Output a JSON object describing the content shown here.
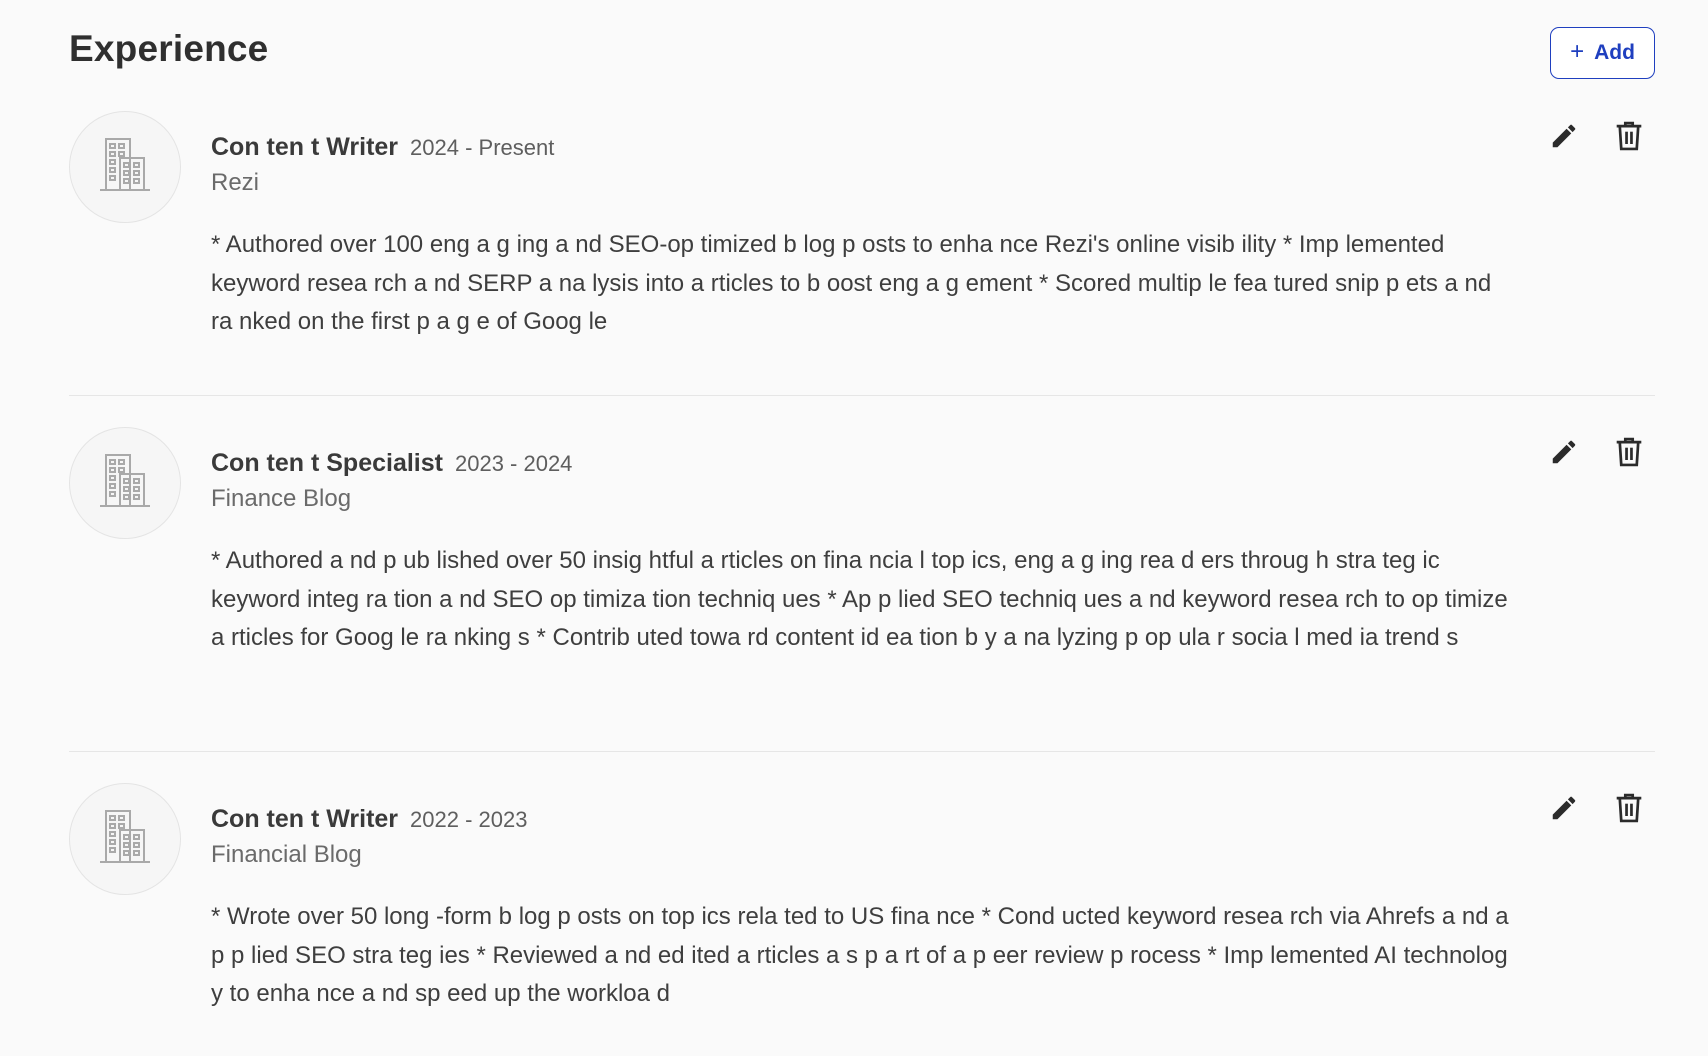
{
  "section": {
    "title": "Experience",
    "add_label": "Add"
  },
  "icons": {
    "add": "plus-icon",
    "logo": "building-icon",
    "edit": "pencil-icon",
    "delete": "trash-icon"
  },
  "colors": {
    "accent": "#1f3fbf",
    "background": "#fafafa",
    "divider": "#e6e6e6"
  },
  "experiences": [
    {
      "role": "Con ten t Writer",
      "dates": "2024 - Present",
      "company": "Rezi",
      "description": "* Authored over 100 eng a g ing a nd SEO-op timized b log p osts to enha nce Rezi's online visib ility * Imp lemented keyword resea rch a nd SERP a na lysis into a rticles to b oost eng a g ement * Scored multip le fea tured snip p ets a nd ra nked on the first p a g e of Goog le"
    },
    {
      "role": "Con ten t Specialist",
      "dates": "2023 - 2024",
      "company": "Finance Blog",
      "description": "* Authored a nd p ub lished over 50 insig htful a rticles on fina ncia l top ics, eng a g ing rea d ers throug h   stra teg ic keyword integ ra tion a nd SEO op timiza tion techniq ues * Ap p lied SEO techniq ues a nd keyword resea rch to op timize a rticles for Goog le ra nking s * Contrib uted towa rd content id ea tion b y a na lyzing p op ula r socia l med ia trend s"
    },
    {
      "role": "Con ten t Writer",
      "dates": "2022 - 2023",
      "company": "Financial Blog",
      "description": "* Wrote over 50 long -form b log p osts on top ics rela ted to US fina nce * Cond ucted keyword resea rch via Ahrefs a nd a p p lied SEO stra teg ies * Reviewed a nd ed ited a rticles a s p a rt of a p eer review p rocess * Imp lemented AI technolog y to enha nce a nd sp eed up the workloa d"
    }
  ]
}
